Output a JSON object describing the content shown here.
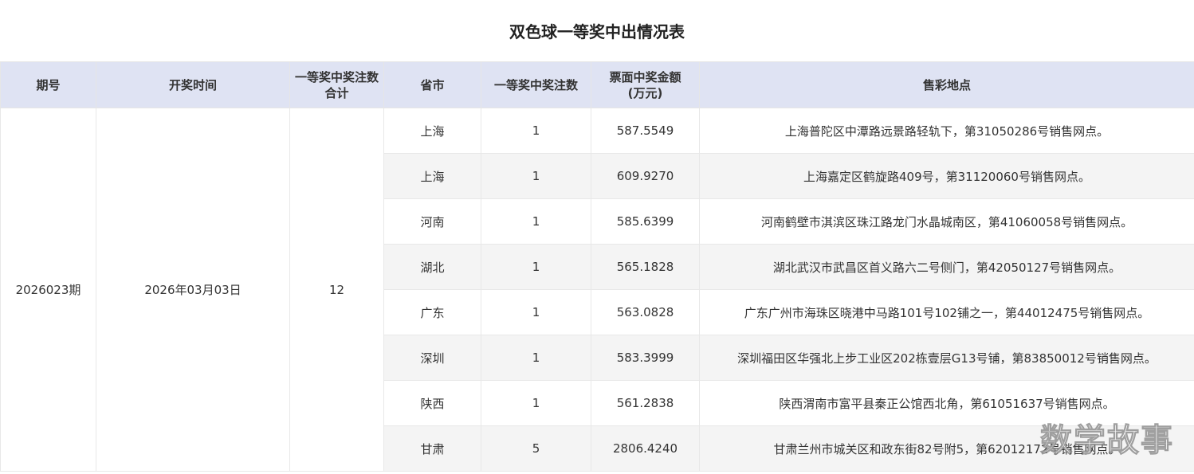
{
  "title": "双色球一等奖中出情况表",
  "headers": {
    "issue": "期号",
    "draw_time": "开奖时间",
    "total_line1": "一等奖中奖注数",
    "total_line2": "合计",
    "province": "省市",
    "count": "一等奖中奖注数",
    "amount_line1": "票面中奖金额",
    "amount_line2": "(万元)",
    "site": "售彩地点"
  },
  "issue": "2026023期",
  "draw_time": "2026年03月03日",
  "total": "12",
  "rows": [
    {
      "province": "上海",
      "count": "1",
      "amount": "587.5549",
      "site": "上海普陀区中潭路远景路轻轨下，第31050286号销售网点。"
    },
    {
      "province": "上海",
      "count": "1",
      "amount": "609.9270",
      "site": "上海嘉定区鹤旋路409号，第31120060号销售网点。"
    },
    {
      "province": "河南",
      "count": "1",
      "amount": "585.6399",
      "site": "河南鹤壁市淇滨区珠江路龙门水晶城南区，第41060058号销售网点。"
    },
    {
      "province": "湖北",
      "count": "1",
      "amount": "565.1828",
      "site": "湖北武汉市武昌区首义路六二号侧门，第42050127号销售网点。"
    },
    {
      "province": "广东",
      "count": "1",
      "amount": "563.0828",
      "site": "广东广州市海珠区晓港中马路101号102铺之一，第44012475号销售网点。"
    },
    {
      "province": "深圳",
      "count": "1",
      "amount": "583.3999",
      "site": "深圳福田区华强北上步工业区202栋壹层G13号铺，第83850012号销售网点。"
    },
    {
      "province": "陕西",
      "count": "1",
      "amount": "561.2838",
      "site": "陕西渭南市富平县秦正公馆西北角，第61051637号销售网点。"
    },
    {
      "province": "甘肃",
      "count": "5",
      "amount": "2806.4240",
      "site": "甘肃兰州市城关区和政东街82号附5，第62012172号销售网点。"
    }
  ],
  "watermark": "数学故事",
  "colors": {
    "header_bg": "#dfe3f3",
    "alt_row_bg": "#f4f4f4",
    "border": "#e8e8e8"
  }
}
